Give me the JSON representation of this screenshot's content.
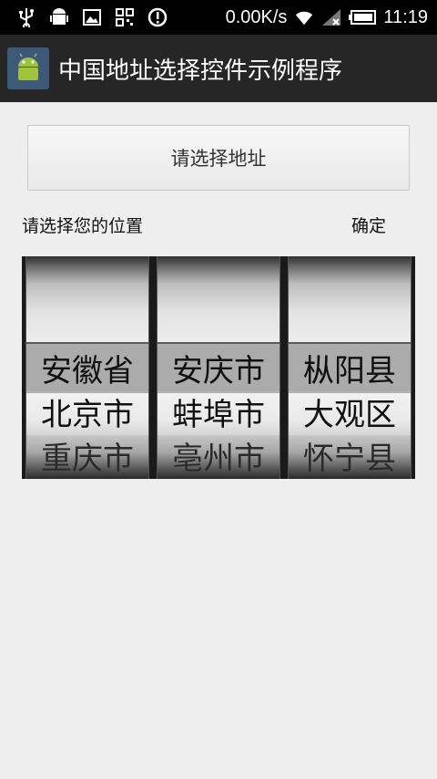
{
  "status_bar": {
    "speed": "0.00K/s",
    "time": "11:19",
    "icons": [
      "usb-icon",
      "android-debug-icon",
      "image-icon",
      "qr-icon",
      "sync-icon",
      "wifi-icon",
      "signal-icon",
      "battery-icon"
    ]
  },
  "action_bar": {
    "title": "中国地址选择控件示例程序"
  },
  "main": {
    "choose_button_label": "请选择地址",
    "prompt_label": "请选择您的位置",
    "confirm_label": "确定"
  },
  "picker": {
    "columns": [
      {
        "items": [
          "安徽省",
          "北京市",
          "重庆市"
        ]
      },
      {
        "items": [
          "安庆市",
          "蚌埠市",
          "亳州市"
        ]
      },
      {
        "items": [
          "枞阳县",
          "大观区",
          "怀宁县"
        ]
      }
    ]
  }
}
